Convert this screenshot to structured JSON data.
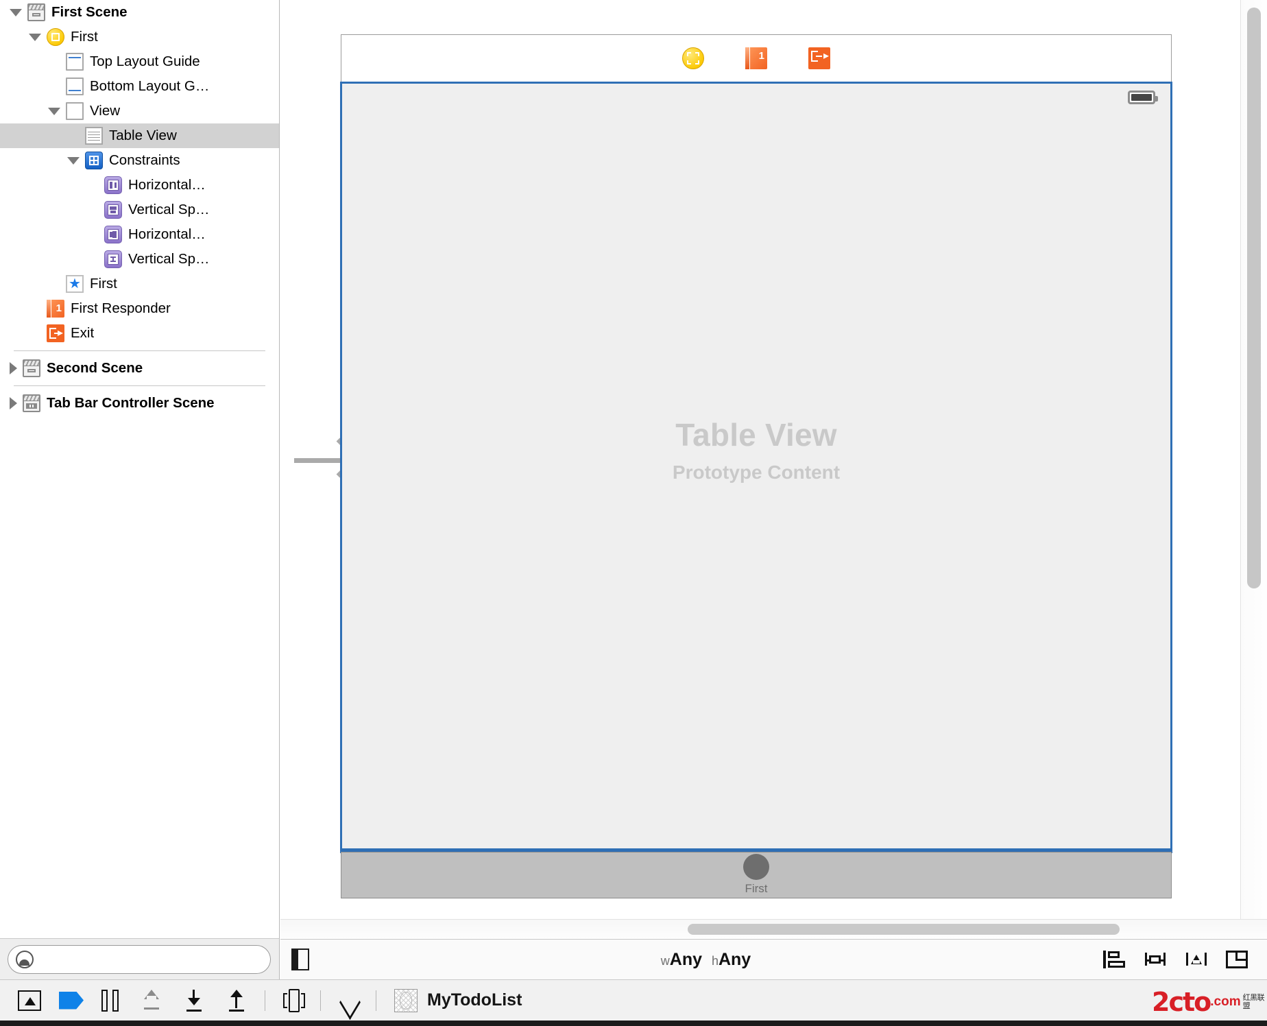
{
  "outline": {
    "rows": [
      {
        "label": "First Scene",
        "icon": "scene-icon",
        "twisty": "down",
        "indent": 14,
        "bold": true,
        "selected": false
      },
      {
        "label": "First",
        "icon": "view-controller-icon",
        "twisty": "down",
        "indent": 42,
        "bold": false,
        "selected": false
      },
      {
        "label": "Top Layout Guide",
        "icon": "top-layout-guide-icon",
        "twisty": "none",
        "indent": 70,
        "bold": false,
        "selected": false
      },
      {
        "label": "Bottom Layout G…",
        "icon": "bottom-layout-guide-icon",
        "twisty": "none",
        "indent": 70,
        "bold": false,
        "selected": false
      },
      {
        "label": "View",
        "icon": "view-icon",
        "twisty": "down",
        "indent": 70,
        "bold": false,
        "selected": false
      },
      {
        "label": "Table View",
        "icon": "table-view-icon",
        "twisty": "none",
        "indent": 98,
        "bold": false,
        "selected": true
      },
      {
        "label": "Constraints",
        "icon": "constraints-icon",
        "twisty": "down",
        "indent": 98,
        "bold": false,
        "selected": false
      },
      {
        "label": "Horizontal…",
        "icon": "horizontal-space-constraint-icon",
        "twisty": "none",
        "indent": 126,
        "bold": false,
        "selected": false
      },
      {
        "label": "Vertical Sp…",
        "icon": "vertical-space-constraint-icon",
        "twisty": "none",
        "indent": 126,
        "bold": false,
        "selected": false
      },
      {
        "label": "Horizontal…",
        "icon": "horizontal-space-constraint-icon-2",
        "twisty": "none",
        "indent": 126,
        "bold": false,
        "selected": false
      },
      {
        "label": "Vertical Sp…",
        "icon": "vertical-space-constraint-icon-2",
        "twisty": "none",
        "indent": 126,
        "bold": false,
        "selected": false
      },
      {
        "label": "First",
        "icon": "star-icon",
        "twisty": "none",
        "indent": 70,
        "bold": false,
        "selected": false
      },
      {
        "label": "First Responder",
        "icon": "first-responder-icon",
        "twisty": "none",
        "indent": 42,
        "bold": false,
        "selected": false
      },
      {
        "label": "Exit",
        "icon": "exit-icon",
        "twisty": "none",
        "indent": 42,
        "bold": false,
        "selected": false
      }
    ],
    "scenes": [
      {
        "label": "Second Scene",
        "icon": "scene-icon",
        "twisty": "right",
        "indent": 14,
        "bold": true
      },
      {
        "label": "Tab Bar Controller Scene",
        "icon": "tab-bar-scene-icon",
        "twisty": "right",
        "indent": 14,
        "bold": true
      }
    ],
    "filter": {
      "placeholder": "",
      "value": "",
      "icon": "filter-icon"
    }
  },
  "canvas": {
    "dock_icons": [
      {
        "name": "view-controller-dock-icon"
      },
      {
        "name": "first-responder-dock-icon"
      },
      {
        "name": "exit-dock-icon"
      }
    ],
    "placeholder_title": "Table View",
    "placeholder_subtitle": "Prototype Content",
    "tab_bar": {
      "item_label": "First"
    },
    "battery_icon": "battery-icon",
    "segue_icon": "entry-point-arrow-icon"
  },
  "canvas_bar": {
    "doc_outline_toggle": "document-outline-toggle",
    "size_class": {
      "width_prefix": "w",
      "width_value": "Any",
      "height_prefix": "h",
      "height_value": "Any"
    },
    "tools": [
      {
        "name": "align-button",
        "label": "Align"
      },
      {
        "name": "pin-button",
        "label": "Pin"
      },
      {
        "name": "resolve-issues-button",
        "label": "Resolve Auto Layout Issues"
      },
      {
        "name": "embed-stack-button",
        "label": "Stack / Resize Behavior"
      }
    ]
  },
  "status_bar": {
    "tools": [
      {
        "name": "debug-view-hierarchy-button"
      },
      {
        "name": "breakpoint-button"
      },
      {
        "name": "pause-button"
      },
      {
        "name": "step-over-button"
      },
      {
        "name": "step-into-button"
      },
      {
        "name": "step-out-button"
      }
    ],
    "project_name": "MyTodoList",
    "three_d_icon": "3d-view-icon",
    "location_icon": "simulate-location-icon",
    "project_icon": "project-icon"
  },
  "watermark": {
    "logo": "2cto",
    "domain": ".com",
    "cn_line1": "红黑联盟",
    "cn_line2": ""
  },
  "colors": {
    "selection_gray": "#d2d2d2",
    "device_border_blue": "#2f6fb5",
    "accent_orange": "#f26322",
    "accent_yellow": "#fcc800",
    "constraint_purple": "#8a72c9",
    "breakpoint_blue": "#0f82e8",
    "watermark_red": "#d81f26"
  }
}
